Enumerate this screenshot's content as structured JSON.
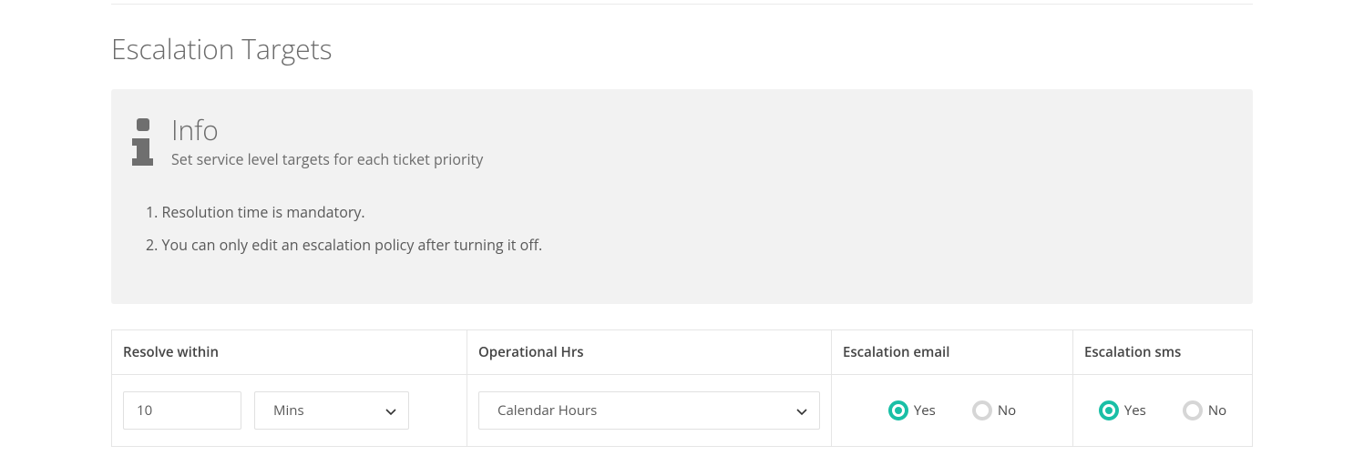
{
  "section_title": "Escalation Targets",
  "info": {
    "title": "Info",
    "subtitle": "Set service level targets for each ticket priority",
    "item1": "1. Resolution time is mandatory.",
    "item2": "2. You can only edit an escalation policy after turning it off."
  },
  "table": {
    "headers": {
      "resolve": "Resolve within",
      "hrs": "Operational Hrs",
      "email": "Escalation email",
      "sms": "Escalation sms"
    },
    "row": {
      "resolve_value": "10",
      "resolve_unit": "Mins",
      "operational_hrs": "Calendar Hours",
      "email_yes": "Yes",
      "email_no": "No",
      "email_selected": "yes",
      "sms_yes": "Yes",
      "sms_no": "No",
      "sms_selected": "yes"
    }
  },
  "colors": {
    "accent": "#19bfa6"
  }
}
